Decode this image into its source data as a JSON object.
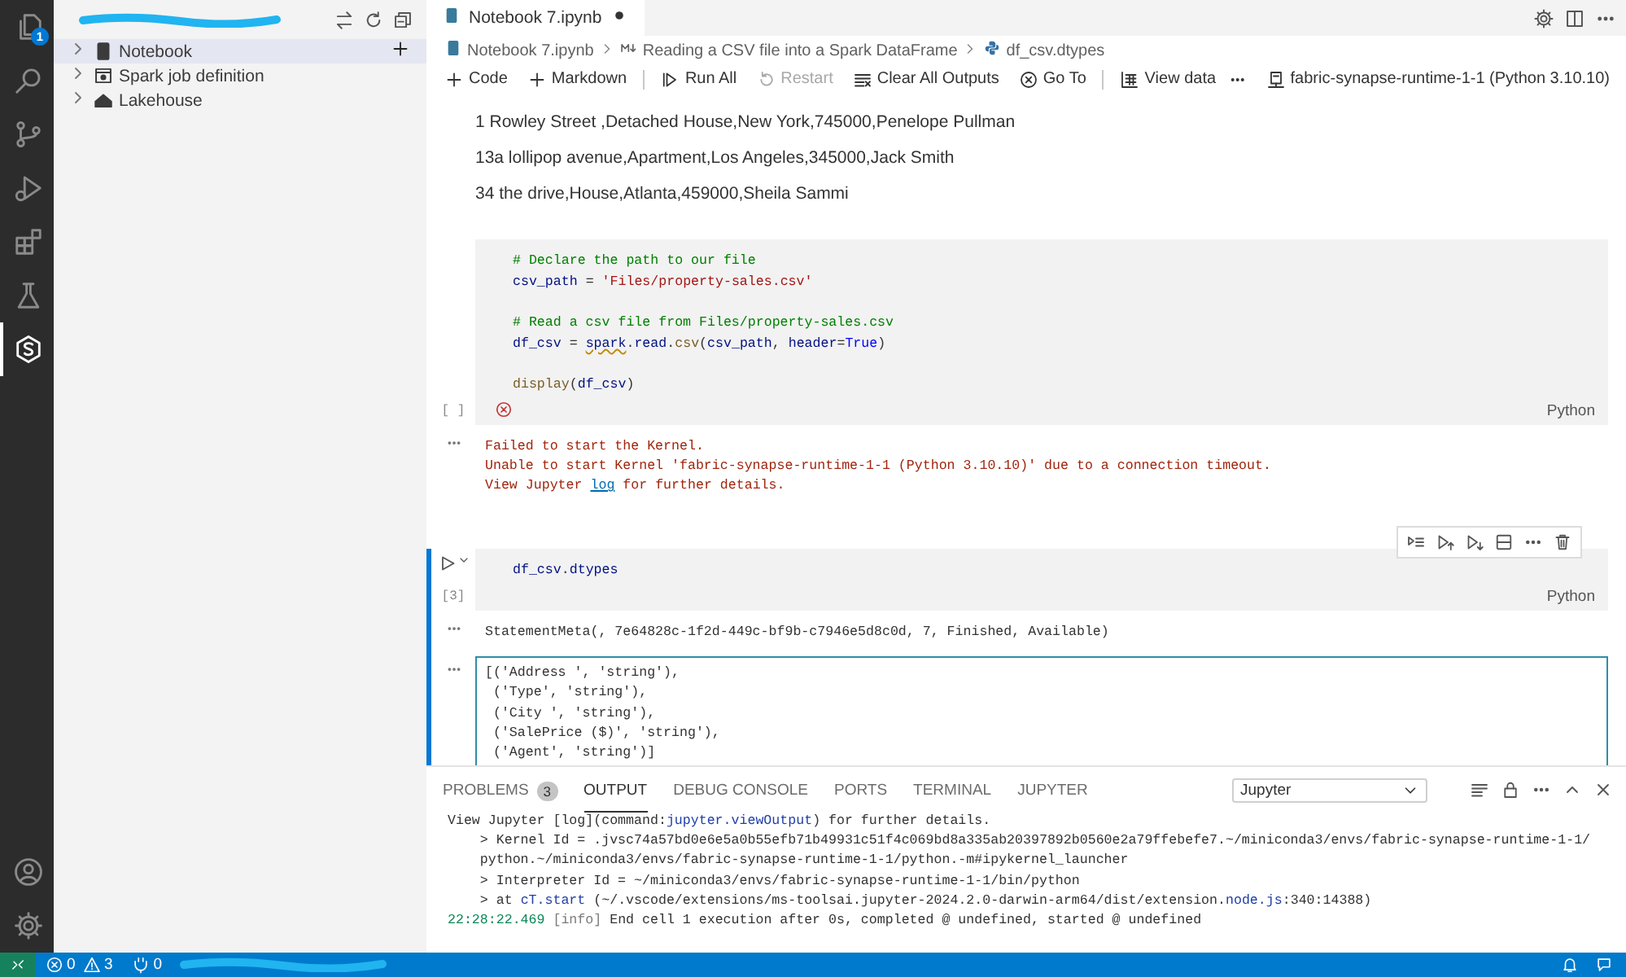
{
  "activity_bar": {
    "items": [
      {
        "kind": "files",
        "badge": "1",
        "selected": false
      },
      {
        "kind": "search",
        "selected": false
      },
      {
        "kind": "source-control",
        "selected": false
      },
      {
        "kind": "run-debug",
        "selected": false
      },
      {
        "kind": "extensions",
        "selected": false
      },
      {
        "kind": "testing",
        "selected": false
      },
      {
        "kind": "synapse",
        "selected": true
      }
    ],
    "bottom_items": [
      {
        "kind": "account"
      },
      {
        "kind": "settings"
      }
    ]
  },
  "sidebar": {
    "items": [
      {
        "kind": "notebook",
        "label": "Notebook",
        "selected": true
      },
      {
        "kind": "spark",
        "label": "Spark job definition",
        "selected": false
      },
      {
        "kind": "lakehouse",
        "label": "Lakehouse",
        "selected": false
      }
    ]
  },
  "editor_tab": {
    "label": "Notebook 7.ipynb",
    "dirty": true
  },
  "breadcrumb": [
    {
      "kind": "notebook",
      "label": "Notebook 7.ipynb"
    },
    {
      "kind": "markdown",
      "label": "Reading a CSV file into a Spark DataFrame"
    },
    {
      "kind": "python",
      "label": "df_csv.dtypes"
    }
  ],
  "toolbar": {
    "items": [
      {
        "kind": "add",
        "label": "Code",
        "disabled": false
      },
      {
        "kind": "add",
        "label": "Markdown",
        "disabled": false
      },
      {
        "kind": "run-all",
        "label": "Run All",
        "disabled": false
      },
      {
        "kind": "restart",
        "label": "Restart",
        "disabled": true
      },
      {
        "kind": "clear",
        "label": "Clear All Outputs",
        "disabled": false
      },
      {
        "kind": "goto",
        "label": "Go To",
        "disabled": false
      },
      {
        "kind": "view-data",
        "label": "View data",
        "disabled": false
      }
    ],
    "kernel": "fabric-synapse-runtime-1-1 (Python 3.10.10)"
  },
  "markdown_lines": [
    "1 Rowley Street ,Detached House,New York,745000,Penelope Pullman",
    "13a lollipop avenue,Apartment,Los Angeles,345000,Jack Smith",
    "34 the drive,House,Atlanta,459000,Sheila Sammi"
  ],
  "cells": [
    {
      "selected": false,
      "execution_count": "[ ]",
      "error": true,
      "language": "Python",
      "code_blocks": [
        [
          [
            {
              "kind": "comment",
              "text": "# Declare the path to our file"
            }
          ],
          [
            {
              "kind": "variable",
              "text": "csv_path"
            },
            {
              "kind": "plain",
              "text": " = "
            },
            {
              "kind": "string",
              "text": "'Files/property-sales.csv'"
            }
          ]
        ],
        [
          [
            {
              "kind": "comment",
              "text": "# Read a csv file from Files/property-sales.csv"
            }
          ],
          [
            {
              "kind": "variable",
              "text": "df_csv"
            },
            {
              "kind": "plain",
              "text": " = "
            },
            {
              "kind": "warning",
              "text": "spark"
            },
            {
              "kind": "plain",
              "text": "."
            },
            {
              "kind": "variable",
              "text": "read"
            },
            {
              "kind": "plain",
              "text": "."
            },
            {
              "kind": "function",
              "text": "csv"
            },
            {
              "kind": "plain",
              "text": "("
            },
            {
              "kind": "variable",
              "text": "csv_path"
            },
            {
              "kind": "plain",
              "text": ", "
            },
            {
              "kind": "variable",
              "text": "header"
            },
            {
              "kind": "plain",
              "text": "="
            },
            {
              "kind": "keyword",
              "text": "True"
            },
            {
              "kind": "plain",
              "text": ")"
            }
          ]
        ],
        [
          [
            {
              "kind": "function",
              "text": "display"
            },
            {
              "kind": "plain",
              "text": "("
            },
            {
              "kind": "variable",
              "text": "df_csv"
            },
            {
              "kind": "plain",
              "text": ")"
            }
          ]
        ]
      ],
      "outputs": [
        {
          "kind": "error",
          "selected": false,
          "lines": [
            [
              {
                "kind": "plain",
                "text": "Failed to start the Kernel."
              }
            ],
            [
              {
                "kind": "plain",
                "text": "Unable to start Kernel 'fabric-synapse-runtime-1-1 (Python 3.10.10)' due to a connection timeout."
              }
            ],
            [
              {
                "kind": "plain",
                "text": "View Jupyter "
              },
              {
                "kind": "link",
                "text": "log"
              },
              {
                "kind": "plain",
                "text": " for further details."
              }
            ]
          ]
        }
      ]
    },
    {
      "selected": true,
      "execution_count": "[3]",
      "error": false,
      "language": "Python",
      "code_blocks": [
        [
          [
            {
              "kind": "variable",
              "text": "df_csv"
            },
            {
              "kind": "plain",
              "text": "."
            },
            {
              "kind": "variable",
              "text": "dtypes"
            }
          ]
        ]
      ],
      "outputs": [
        {
          "kind": "text",
          "selected": false,
          "lines": [
            [
              {
                "kind": "plain",
                "text": "StatementMeta(, 7e64828c-1f2d-449c-bf9b-c7946e5d8c0d, 7, Finished, Available)"
              }
            ]
          ]
        },
        {
          "kind": "text",
          "selected": true,
          "lines": [
            [
              {
                "kind": "plain",
                "text": "[('Address ', 'string'),"
              }
            ],
            [
              {
                "kind": "plain",
                "text": " ('Type', 'string'),"
              }
            ],
            [
              {
                "kind": "plain",
                "text": " ('City ', 'string'),"
              }
            ],
            [
              {
                "kind": "plain",
                "text": " ('SalePrice ($)', 'string'),"
              }
            ],
            [
              {
                "kind": "plain",
                "text": " ('Agent', 'string')]"
              }
            ]
          ]
        }
      ]
    }
  ],
  "panel": {
    "tabs": [
      {
        "label": "PROBLEMS",
        "badge": "3",
        "selected": false
      },
      {
        "label": "OUTPUT",
        "selected": true
      },
      {
        "label": "DEBUG CONSOLE",
        "selected": false
      },
      {
        "label": "PORTS",
        "selected": false
      },
      {
        "label": "TERMINAL",
        "selected": false
      },
      {
        "label": "JUPYTER",
        "selected": false
      }
    ],
    "channel": "Jupyter",
    "log": [
      [
        {
          "kind": "plain",
          "text": "View Jupyter [log](command:"
        },
        {
          "kind": "command",
          "text": "jupyter.viewOutput"
        },
        {
          "kind": "plain",
          "text": ") for further details."
        }
      ],
      [
        {
          "kind": "plain",
          "text": "    > Kernel Id = .jvsc74a57bd0e6e5a0b55efb71b49931c51f4c069bd8a335ab20397892b0560e2a79ffebefe7.~/miniconda3/envs/fabric-synapse-runtime-1-1/"
        }
      ],
      [
        {
          "kind": "plain",
          "text": "    python.~/miniconda3/envs/fabric-synapse-runtime-1-1/python.-m#ipykernel_launcher"
        }
      ],
      [
        {
          "kind": "plain",
          "text": "    > Interpreter Id = ~/miniconda3/envs/fabric-synapse-runtime-1-1/bin/python"
        }
      ],
      [
        {
          "kind": "plain",
          "text": "    > at "
        },
        {
          "kind": "command",
          "text": "cT.start"
        },
        {
          "kind": "plain",
          "text": " (~/.vscode/extensions/ms-toolsai.jupyter-2024.2.0-darwin-arm64/dist/extension."
        },
        {
          "kind": "command",
          "text": "node.js"
        },
        {
          "kind": "plain",
          "text": ":340:14388)"
        }
      ],
      [
        {
          "kind": "time",
          "text": "22:28:22.469"
        },
        {
          "kind": "info",
          "text": " [info]"
        },
        {
          "kind": "plain",
          "text": " End cell 1 execution after 0s, completed @ undefined, started @ undefined"
        }
      ]
    ]
  },
  "status_bar": {
    "errors": "0",
    "warnings": "3",
    "ports": "0"
  }
}
